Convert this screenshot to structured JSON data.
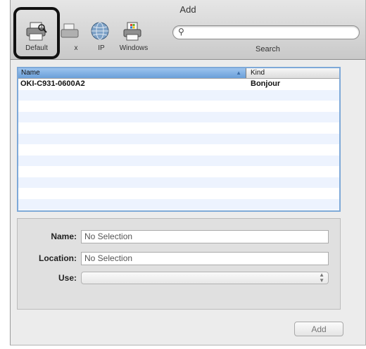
{
  "window": {
    "title": "Add"
  },
  "toolbar": {
    "buttons": [
      {
        "label": "Default",
        "icon": "printer-magnifier-icon"
      },
      {
        "label": "Fax",
        "icon": "fax-icon"
      },
      {
        "label": "IP",
        "icon": "globe-icon"
      },
      {
        "label": "Windows",
        "icon": "windows-printer-icon"
      }
    ],
    "visible_fax_label": "x",
    "search": {
      "placeholder": "",
      "value": "",
      "label": "Search"
    }
  },
  "printer_list": {
    "columns": [
      "Name",
      "Kind"
    ],
    "rows": [
      {
        "name": "OKI-C931-0600A2",
        "kind": "Bonjour"
      }
    ]
  },
  "details": {
    "name_label": "Name:",
    "name_value": "No Selection",
    "location_label": "Location:",
    "location_value": "No Selection",
    "use_label": "Use:",
    "use_value": ""
  },
  "footer": {
    "add_label": "Add"
  },
  "colors": {
    "selection_header": "#6a9fd9",
    "list_border": "#7ea9d8",
    "highlight_box": "#111111"
  }
}
